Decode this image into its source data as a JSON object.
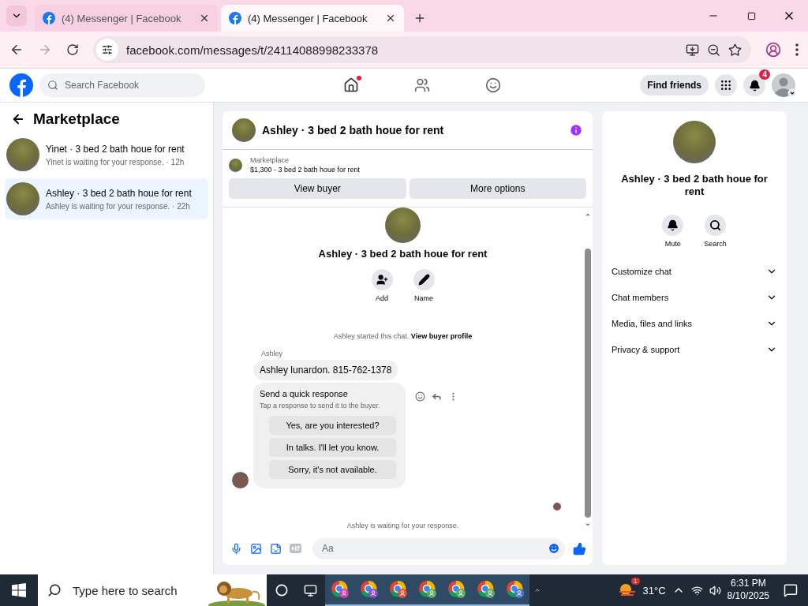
{
  "browser": {
    "tabs": [
      {
        "title": "(4) Messenger | Facebook",
        "selected": false
      },
      {
        "title": "(4) Messenger | Facebook",
        "selected": true
      }
    ],
    "address": "facebook.com/messages/t/24114088998233378"
  },
  "header": {
    "search": {
      "placeholder": "Search Facebook"
    },
    "nav": [
      {
        "kind": "home",
        "selected": true
      },
      {
        "kind": "friends",
        "selected": false
      },
      {
        "kind": "groups",
        "selected": false
      }
    ],
    "find_friends": "Find friends",
    "notification_count": "4"
  },
  "sidebar": {
    "title": "Marketplace",
    "threads": [
      {
        "name": "Yinet · 3 bed 2 bath houe for rent",
        "preview": "Yinet is waiting for your response. · 12h",
        "selected": false
      },
      {
        "name": "Ashley · 3 bed 2 bath houe for rent",
        "preview": "Ashley is waiting for your response. · 22h",
        "selected": true
      }
    ]
  },
  "chat": {
    "title": "Ashley · 3 bed 2 bath houe for rent",
    "listing": {
      "label": "Marketplace",
      "title": "$1,300 - 3 bed 2 bath houe for rent"
    },
    "buttons": [
      "View buyer",
      "More options"
    ],
    "intro": {
      "title": "Ashley · 3 bed 2 bath houe for rent",
      "actions": [
        {
          "kind": "add",
          "label": "Add"
        },
        {
          "kind": "name",
          "label": "Name"
        }
      ]
    },
    "system_message": {
      "text": "Ashley started this chat.",
      "link": "View buyer profile"
    },
    "sender": "Ashley",
    "message": "Ashley lunardon. 815-762-1378",
    "quick_response": {
      "title": "Send a quick response",
      "subtitle": "Tap a response to send it to the buyer.",
      "options": [
        "Yes, are you interested?",
        "In talks. I'll let you know.",
        "Sorry, it's not available."
      ]
    },
    "status": "Ashley is waiting for your response.",
    "composer": {
      "placeholder": "Aa"
    }
  },
  "details": {
    "title": "Ashley · 3 bed 2 bath houe for rent",
    "actions": [
      {
        "kind": "mute",
        "label": "Mute"
      },
      {
        "kind": "search",
        "label": "Search"
      }
    ],
    "sections": [
      {
        "label": "Customize chat",
        "expanded": false
      },
      {
        "label": "Chat members",
        "expanded": false
      },
      {
        "label": "Media, files and links",
        "expanded": false
      },
      {
        "label": "Privacy & support",
        "expanded": false
      }
    ]
  },
  "taskbar": {
    "search": {
      "placeholder": "Type here to search"
    },
    "apps": [
      {
        "color": "#d63ab4"
      },
      {
        "color": "#8e4ad0"
      },
      {
        "color": "#e0503a"
      },
      {
        "color": "#5aa86a"
      },
      {
        "color": "#5aa86a"
      },
      {
        "color": "#5aa86a"
      },
      {
        "color": "#4a7ad8"
      }
    ],
    "weather_badge": "1",
    "temperature": "31°C",
    "time": "6:31 PM",
    "date": "8/10/2025"
  }
}
